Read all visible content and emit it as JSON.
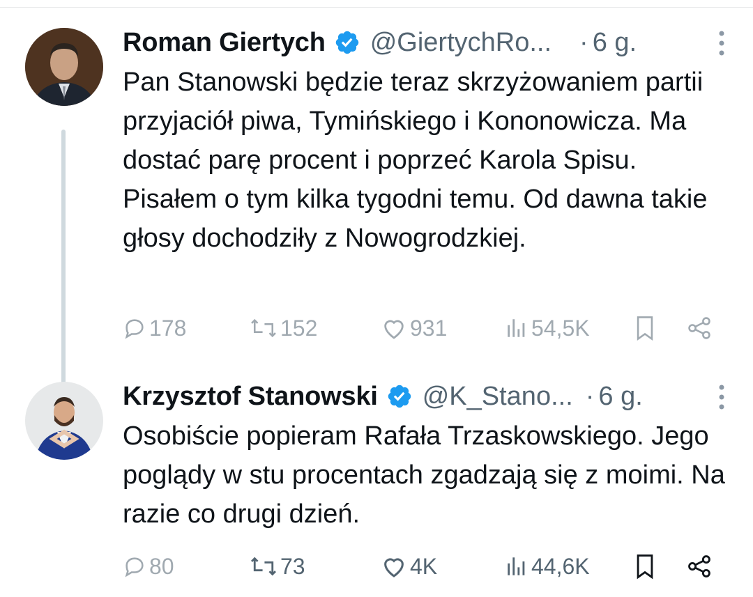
{
  "tweets": [
    {
      "author": "Roman Giertych",
      "handle": "@GiertychRo...",
      "separator": "·",
      "time": "6 g.",
      "text": "Pan Stanowski będzie teraz skrzyżowaniem partii przyjaciół piwa, Tymińskiego i Kononowicza. Ma dostać parę procent i poprzeć Karola Spisu. Pisałem o tym kilka tygodni temu. Od dawna takie głosy dochodziły z Nowogrodzkiej.",
      "replies": "178",
      "reposts": "152",
      "likes": "931",
      "views": "54,5K"
    },
    {
      "author": "Krzysztof Stanowski",
      "handle": "@K_Stano...",
      "separator": "·",
      "time": "6 g.",
      "text": "Osobiście popieram Rafała Trzaskowskiego. Jego poglądy w stu procentach zgadzają się z moimi. Na razie co drugi dzień.",
      "replies": "80",
      "reposts": "73",
      "likes": "4K",
      "views": "44,6K"
    }
  ],
  "icons": {
    "verified": "verified-badge-icon",
    "more": "more-vertical-icon",
    "reply": "reply-icon",
    "repost": "repost-icon",
    "like": "heart-icon",
    "views": "views-icon",
    "bookmark": "bookmark-icon",
    "share": "share-icon"
  },
  "colors": {
    "text": "#0f1419",
    "secondary": "#536471",
    "verified": "#1d9bf0",
    "thread_line": "#cfd9de"
  }
}
